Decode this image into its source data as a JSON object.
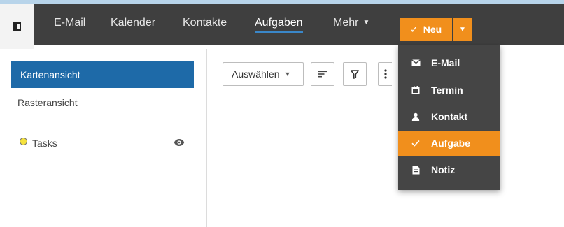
{
  "nav": {
    "items": [
      {
        "label": "E-Mail",
        "active": false
      },
      {
        "label": "Kalender",
        "active": false
      },
      {
        "label": "Kontakte",
        "active": false
      },
      {
        "label": "Aufgaben",
        "active": true
      },
      {
        "label": "Mehr",
        "active": false
      }
    ],
    "new_button_label": "Neu"
  },
  "new_menu": {
    "items": [
      {
        "label": "E-Mail",
        "icon": "envelope-icon",
        "selected": false
      },
      {
        "label": "Termin",
        "icon": "calendar-icon",
        "selected": false
      },
      {
        "label": "Kontakt",
        "icon": "person-icon",
        "selected": false
      },
      {
        "label": "Aufgabe",
        "icon": "checkmark-icon",
        "selected": true
      },
      {
        "label": "Notiz",
        "icon": "note-icon",
        "selected": false
      }
    ]
  },
  "sidebar": {
    "views": [
      {
        "label": "Kartenansicht",
        "selected": true
      },
      {
        "label": "Rasteransicht",
        "selected": false
      }
    ],
    "folders": [
      {
        "label": "Tasks",
        "color": "#f5e23d",
        "visible": true
      }
    ]
  },
  "toolbar": {
    "select_label": "Auswählen"
  },
  "colors": {
    "nav_bg": "#3f3f3f",
    "accent_orange": "#f18f1c",
    "selected_blue": "#1e6aa8",
    "menu_bg": "#454545"
  }
}
